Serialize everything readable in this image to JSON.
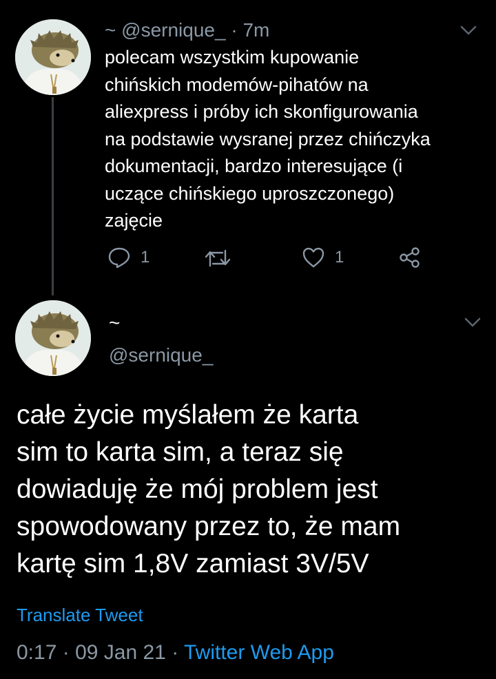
{
  "tweet1": {
    "display_name": "~",
    "handle": "@sernique_",
    "separator": "·",
    "time": "7m",
    "lines": [
      "polecam wszystkim kupowanie",
      "chińskich modemów-pihatów na",
      "aliexpress i próby ich skonfigurowania",
      "na podstawie wysranej przez chińczyka",
      "dokumentacji, bardzo interesujące (i",
      "uczące chińskiego uproszczonego)",
      "zajęcie"
    ],
    "reply_count": "1",
    "like_count": "1",
    "icons": [
      "reply-icon",
      "retweet-icon",
      "like-icon",
      "share-icon",
      "chevron-down-icon"
    ]
  },
  "tweet2": {
    "display_name": "~",
    "handle": "@sernique_",
    "lines": [
      "całe życie myślałem że karta",
      "sim to karta sim, a teraz się",
      "dowiaduję że mój problem jest",
      "spowodowany przez to, że mam",
      "kartę sim 1,8V zamiast 3V/5V"
    ],
    "translate_label": "Translate Tweet",
    "time": "0:17",
    "date": "09 Jan 21",
    "separator": "·",
    "source": "Twitter Web App"
  },
  "colors": {
    "background": "#000000",
    "text_primary": "#ffffff",
    "text_secondary": "#8b98a5",
    "accent": "#1d9bf0",
    "thread_line": "#3b3f43"
  }
}
